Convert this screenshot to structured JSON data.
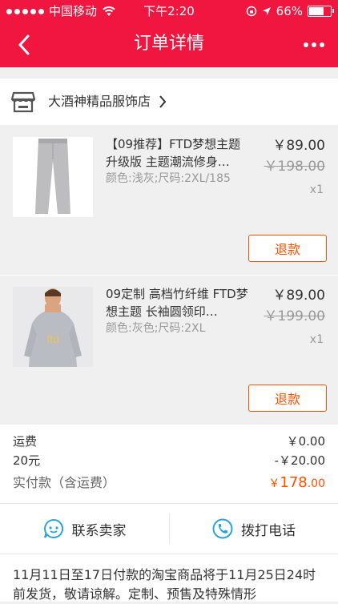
{
  "status_bar": {
    "carrier": "中国移动",
    "time": "下午2:20",
    "battery": "66%"
  },
  "nav": {
    "title": "订单详情",
    "back_icon": "chevron-left-icon",
    "more_icon": "more-dots-icon"
  },
  "store": {
    "icon": "store-icon",
    "name": "大酒神精品服饰店"
  },
  "products": [
    {
      "title": "【09推荐】FTD梦想主题升级版 主题潮流修身…",
      "spec": "颜色:浅灰;尺码:2XL/185",
      "price": "￥89.00",
      "original_price": "￥198.00",
      "qty": "x1",
      "refund_label": "退款"
    },
    {
      "title": "09定制 高档竹纤维 FTD梦想主题 长袖圆领印…",
      "spec": "颜色:灰色;尺码:2XL",
      "price": "￥89.00",
      "original_price": "￥199.00",
      "qty": "x1",
      "refund_label": "退款"
    }
  ],
  "totals": {
    "shipping_label": "运费",
    "shipping_value": "￥0.00",
    "discount_label": "20元",
    "discount_value": "-￥20.00",
    "paid_label": "实付款（含运费）",
    "paid_currency": "￥",
    "paid_int": "178",
    "paid_dec": ".00"
  },
  "contact": {
    "seller_label": "联系卖家",
    "call_label": "拨打电话"
  },
  "notice": {
    "text": "11月11日至17日付款的淘宝商品将于11月25日24时前发货，敬请谅解。定制、预售及特殊情形"
  },
  "colors": {
    "brand_red": "#f0163f",
    "accent_orange": "#ff5000",
    "contact_blue": "#2aa4dd"
  }
}
